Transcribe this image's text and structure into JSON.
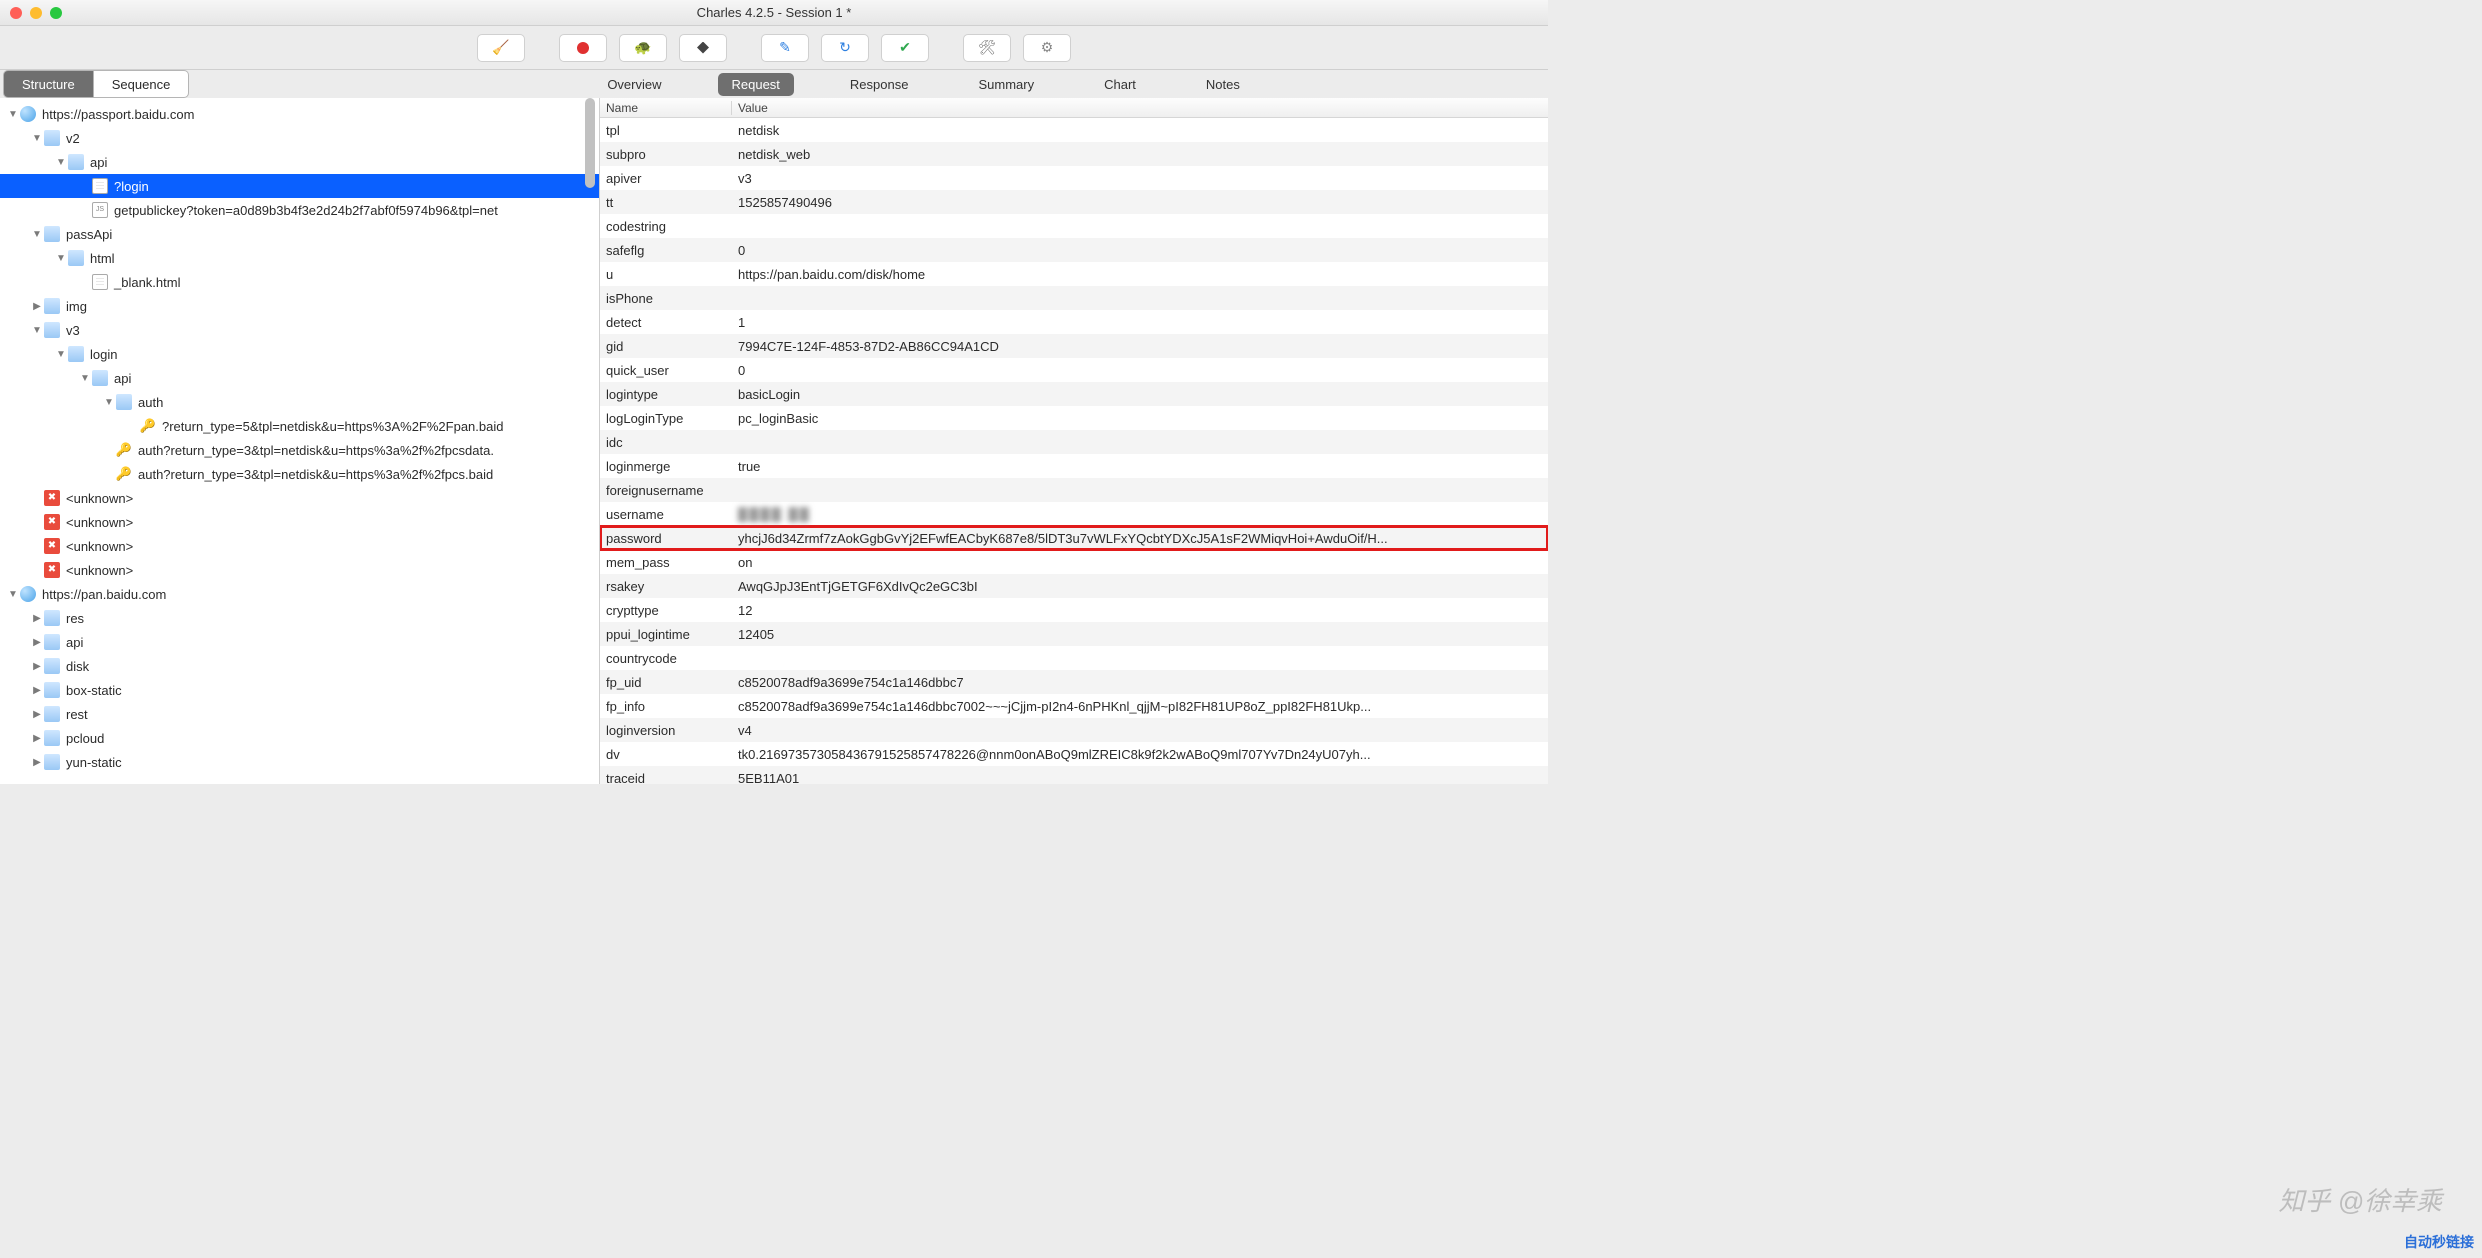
{
  "window": {
    "title": "Charles 4.2.5 - Session 1 *"
  },
  "viewTabs": {
    "structure": "Structure",
    "sequence": "Sequence"
  },
  "panelTabs": {
    "overview": "Overview",
    "request": "Request",
    "response": "Response",
    "summary": "Summary",
    "chart": "Chart",
    "notes": "Notes"
  },
  "tree": [
    {
      "depth": 0,
      "twisty": "down",
      "icon": "globe",
      "label": "https://passport.baidu.com"
    },
    {
      "depth": 1,
      "twisty": "down",
      "icon": "folder",
      "label": "v2"
    },
    {
      "depth": 2,
      "twisty": "down",
      "icon": "folder",
      "label": "api"
    },
    {
      "depth": 3,
      "twisty": "",
      "icon": "doc",
      "label": "?login",
      "selected": true
    },
    {
      "depth": 3,
      "twisty": "",
      "icon": "js",
      "label": "getpublickey?token=a0d89b3b4f3e2d24b2f7abf0f5974b96&tpl=net"
    },
    {
      "depth": 1,
      "twisty": "down",
      "icon": "folder",
      "label": "passApi"
    },
    {
      "depth": 2,
      "twisty": "down",
      "icon": "folder",
      "label": "html"
    },
    {
      "depth": 3,
      "twisty": "",
      "icon": "doc",
      "label": "_blank.html"
    },
    {
      "depth": 1,
      "twisty": "right",
      "icon": "folder",
      "label": "img"
    },
    {
      "depth": 1,
      "twisty": "down",
      "icon": "folder",
      "label": "v3"
    },
    {
      "depth": 2,
      "twisty": "down",
      "icon": "folder",
      "label": "login"
    },
    {
      "depth": 3,
      "twisty": "down",
      "icon": "folder",
      "label": "api"
    },
    {
      "depth": 4,
      "twisty": "down",
      "icon": "folder",
      "label": "auth"
    },
    {
      "depth": 5,
      "twisty": "",
      "icon": "key",
      "label": "?return_type=5&tpl=netdisk&u=https%3A%2F%2Fpan.baid"
    },
    {
      "depth": 4,
      "twisty": "",
      "icon": "key",
      "label": "auth?return_type=3&tpl=netdisk&u=https%3a%2f%2fpcsdata."
    },
    {
      "depth": 4,
      "twisty": "",
      "icon": "key",
      "label": "auth?return_type=3&tpl=netdisk&u=https%3a%2f%2fpcs.baid"
    },
    {
      "depth": 1,
      "twisty": "",
      "icon": "err",
      "label": "<unknown>"
    },
    {
      "depth": 1,
      "twisty": "",
      "icon": "err",
      "label": "<unknown>"
    },
    {
      "depth": 1,
      "twisty": "",
      "icon": "err",
      "label": "<unknown>"
    },
    {
      "depth": 1,
      "twisty": "",
      "icon": "err",
      "label": "<unknown>"
    },
    {
      "depth": 0,
      "twisty": "down",
      "icon": "globe",
      "label": "https://pan.baidu.com"
    },
    {
      "depth": 1,
      "twisty": "right",
      "icon": "folder",
      "label": "res"
    },
    {
      "depth": 1,
      "twisty": "right",
      "icon": "folder",
      "label": "api"
    },
    {
      "depth": 1,
      "twisty": "right",
      "icon": "folder",
      "label": "disk"
    },
    {
      "depth": 1,
      "twisty": "right",
      "icon": "folder",
      "label": "box-static"
    },
    {
      "depth": 1,
      "twisty": "right",
      "icon": "folder",
      "label": "rest"
    },
    {
      "depth": 1,
      "twisty": "right",
      "icon": "folder",
      "label": "pcloud"
    },
    {
      "depth": 1,
      "twisty": "right",
      "icon": "folder",
      "label": "yun-static"
    }
  ],
  "detail": {
    "headers": {
      "name": "Name",
      "value": "Value"
    },
    "rows": [
      {
        "name": "tpl",
        "value": "netdisk"
      },
      {
        "name": "subpro",
        "value": "netdisk_web"
      },
      {
        "name": "apiver",
        "value": "v3"
      },
      {
        "name": "tt",
        "value": "1525857490496"
      },
      {
        "name": "codestring",
        "value": ""
      },
      {
        "name": "safeflg",
        "value": "0"
      },
      {
        "name": "u",
        "value": "https://pan.baidu.com/disk/home"
      },
      {
        "name": "isPhone",
        "value": ""
      },
      {
        "name": "detect",
        "value": "1"
      },
      {
        "name": "gid",
        "value": "7994C7E-124F-4853-87D2-AB86CC94A1CD"
      },
      {
        "name": "quick_user",
        "value": "0"
      },
      {
        "name": "logintype",
        "value": "basicLogin"
      },
      {
        "name": "logLoginType",
        "value": "pc_loginBasic"
      },
      {
        "name": "idc",
        "value": ""
      },
      {
        "name": "loginmerge",
        "value": "true"
      },
      {
        "name": "foreignusername",
        "value": ""
      },
      {
        "name": "username",
        "value": "████ ██",
        "blurred": true
      },
      {
        "name": "password",
        "value": "yhcjJ6d34Zrmf7zAokGgbGvYj2EFwfEACbyK687e8/5lDT3u7vWLFxYQcbtYDXcJ5A1sF2WMiqvHoi+AwduOif/H...",
        "highlight": true
      },
      {
        "name": "mem_pass",
        "value": "on"
      },
      {
        "name": "rsakey",
        "value": "AwqGJpJ3EntTjGETGF6XdIvQc2eGC3bI"
      },
      {
        "name": "crypttype",
        "value": "12"
      },
      {
        "name": "ppui_logintime",
        "value": "12405"
      },
      {
        "name": "countrycode",
        "value": ""
      },
      {
        "name": "fp_uid",
        "value": "c8520078adf9a3699e754c1a146dbbc7"
      },
      {
        "name": "fp_info",
        "value": "c8520078adf9a3699e754c1a146dbbc7002~~~jCjjm-pI2n4-6nPHKnl_qjjM~pI82FH81UP8oZ_ppI82FH81Ukp..."
      },
      {
        "name": "loginversion",
        "value": "v4"
      },
      {
        "name": "dv",
        "value": "tk0.216973573058436791525857478226@nnm0onABoQ9mlZREIC8k9f2k2wABoQ9ml707Yv7Dn24yU07yh..."
      },
      {
        "name": "traceid",
        "value": "5EB11A01"
      }
    ]
  },
  "watermark": "知乎 @徐幸乘",
  "linkbadge": "自动秒链接"
}
